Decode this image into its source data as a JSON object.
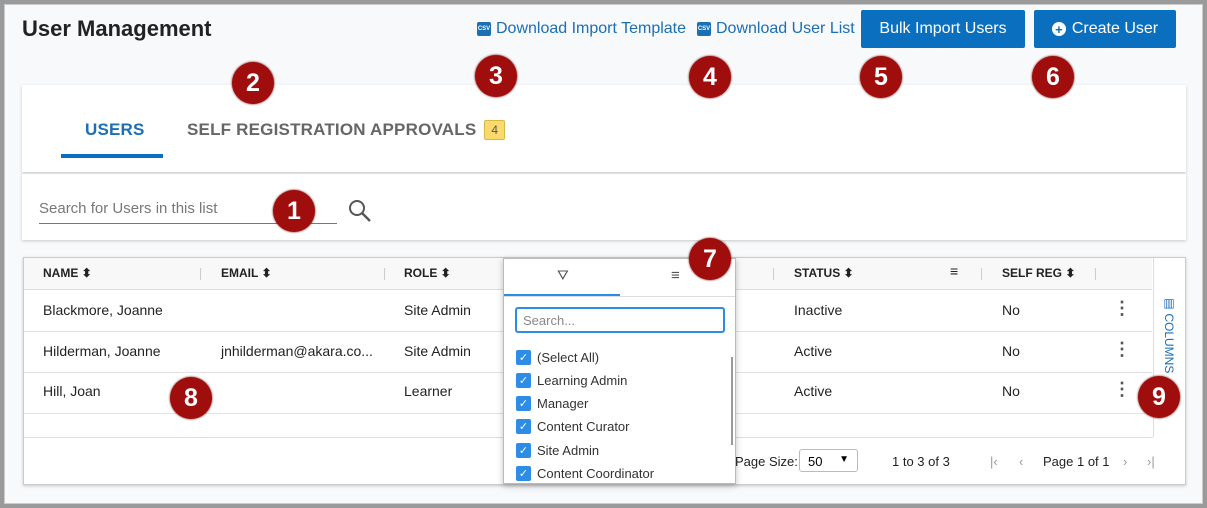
{
  "header": {
    "title": "User Management",
    "links": [
      "Download Import Template",
      "Download User List"
    ],
    "csv_icon": "CSV",
    "bulk_import": "Bulk Import Users",
    "create_user": "Create User"
  },
  "tabs": [
    {
      "label": "USERS",
      "active": true
    },
    {
      "label": "SELF REGISTRATION APPROVALS",
      "badge": "4"
    }
  ],
  "search": {
    "placeholder": "Search for Users in this list"
  },
  "grid": {
    "columns": [
      "NAME",
      "EMAIL",
      "ROLE",
      "STATUS",
      "SELF REG"
    ],
    "rows": [
      {
        "name": "Blackmore, Joanne",
        "email": "",
        "role": "Site Admin",
        "status": "Inactive",
        "self_reg": "No"
      },
      {
        "name": "Hilderman, Joanne",
        "email": "jnhilderman@akara.co...",
        "role": "Site Admin",
        "status": "Active",
        "self_reg": "No"
      },
      {
        "name": "Hill, Joan",
        "email": "",
        "role": "Learner",
        "status": "Active",
        "self_reg": "No"
      }
    ],
    "side_panel": "COLUMNS",
    "footer": {
      "page_size_label": "Page Size:",
      "page_size": "50",
      "range": "1 to 3 of 3",
      "page": "Page 1 of 1"
    }
  },
  "filter_popup": {
    "placeholder": "Search...",
    "options": [
      {
        "label": "(Select All)",
        "checked": true
      },
      {
        "label": "Learning Admin",
        "checked": true
      },
      {
        "label": "Manager",
        "checked": true
      },
      {
        "label": "Content Curator",
        "checked": true
      },
      {
        "label": "Site Admin",
        "checked": true
      },
      {
        "label": "Content Coordinator",
        "checked": true
      }
    ]
  },
  "annotations": [
    "1",
    "2",
    "3",
    "4",
    "5",
    "6",
    "7",
    "8",
    "9"
  ],
  "colors": {
    "accent": "#0b6fc0",
    "annotation": "#a00d0d",
    "badge": "#fbd96a"
  }
}
